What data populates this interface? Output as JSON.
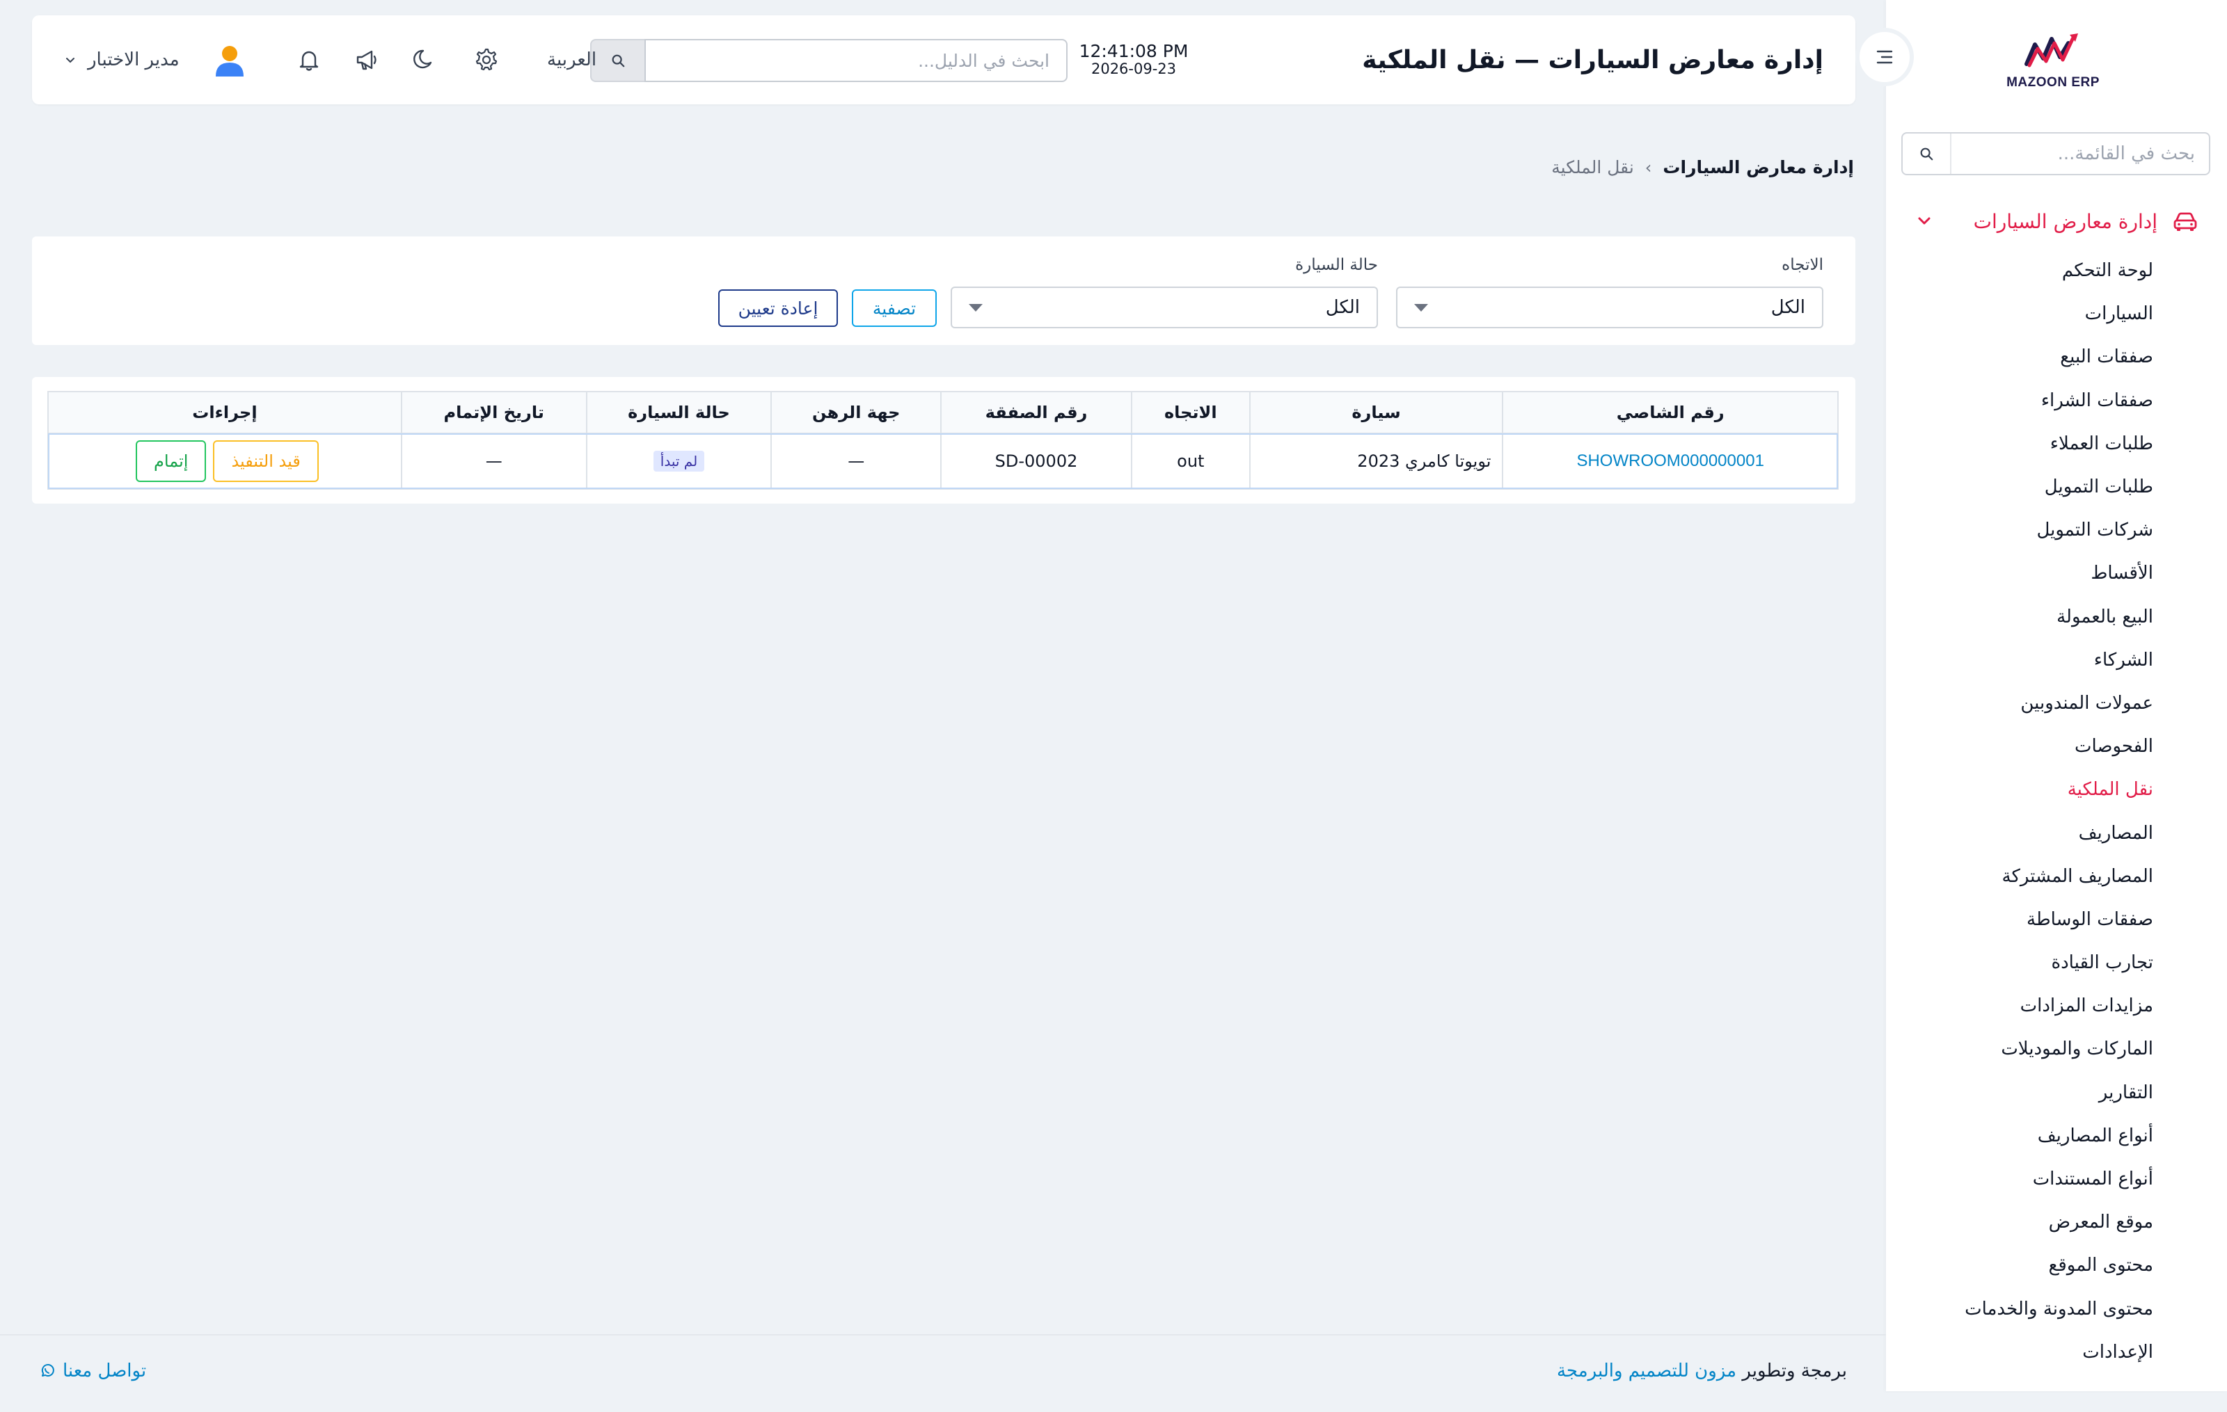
{
  "app": {
    "logo_text": "MAZOON ERP",
    "page_title": "إدارة معارض السيارات — نقل الملكية"
  },
  "header": {
    "time": "12:41:08 PM",
    "date": "2026-09-23",
    "search_placeholder": "ابحث في الدليل...",
    "language": "العربية",
    "user_name": "مدير الاختبار",
    "icons": [
      "search-icon",
      "gear-icon",
      "moon-icon",
      "megaphone-icon",
      "bell-icon",
      "avatar",
      "menu-icon"
    ]
  },
  "sidebar": {
    "search_placeholder": "بحث في القائمة...",
    "group_label": "إدارة معارض السيارات",
    "items": [
      {
        "label": "لوحة التحكم"
      },
      {
        "label": "السيارات"
      },
      {
        "label": "صفقات البيع"
      },
      {
        "label": "صفقات الشراء"
      },
      {
        "label": "طلبات العملاء"
      },
      {
        "label": "طلبات التمويل"
      },
      {
        "label": "شركات التمويل"
      },
      {
        "label": "الأقساط"
      },
      {
        "label": "البيع بالعمولة"
      },
      {
        "label": "الشركاء"
      },
      {
        "label": "عمولات المندوبين"
      },
      {
        "label": "الفحوصات"
      },
      {
        "label": "نقل الملكية",
        "active": true
      },
      {
        "label": "المصاريف"
      },
      {
        "label": "المصاريف المشتركة"
      },
      {
        "label": "صفقات الوساطة"
      },
      {
        "label": "تجارب القيادة"
      },
      {
        "label": "مزايدات المزادات"
      },
      {
        "label": "الماركات والموديلات"
      },
      {
        "label": "التقارير"
      },
      {
        "label": "أنواع المصاريف"
      },
      {
        "label": "أنواع المستندات"
      },
      {
        "label": "موقع المعرض"
      },
      {
        "label": "محتوى الموقع"
      },
      {
        "label": "محتوى المدونة والخدمات"
      },
      {
        "label": "الإعدادات"
      }
    ]
  },
  "breadcrumb": {
    "root": "إدارة معارض السيارات",
    "separator": "›",
    "current": "نقل الملكية"
  },
  "filters": {
    "direction_label": "الاتجاه",
    "direction_value": "الكل",
    "car_status_label": "حالة السيارة",
    "car_status_value": "الكل",
    "filter_button": "تصفية",
    "reset_button": "إعادة تعيين"
  },
  "table": {
    "headers": [
      "رقم الشاصي",
      "سيارة",
      "الاتجاه",
      "رقم الصفقة",
      "جهة الرهن",
      "حالة السيارة",
      "تاريخ الإتمام",
      "إجراءات"
    ],
    "rows": [
      {
        "chassis": "SHOWROOM000000001",
        "car": "تويوتا كامري 2023",
        "direction": "out",
        "deal_no": "SD-00002",
        "lien": "—",
        "status": "لم تبدأ",
        "completed_date": "—",
        "action_in_progress": "قيد التنفيذ",
        "action_complete": "إتمام"
      }
    ]
  },
  "footer": {
    "credit_prefix": "برمجة وتطوير",
    "credit_brand": "مزون للتصميم والبرمجة",
    "contact": "تواصل معنا"
  },
  "colors": {
    "accent_red": "#e11d48",
    "link_blue": "#0284c7",
    "background": "#eef2f6"
  }
}
